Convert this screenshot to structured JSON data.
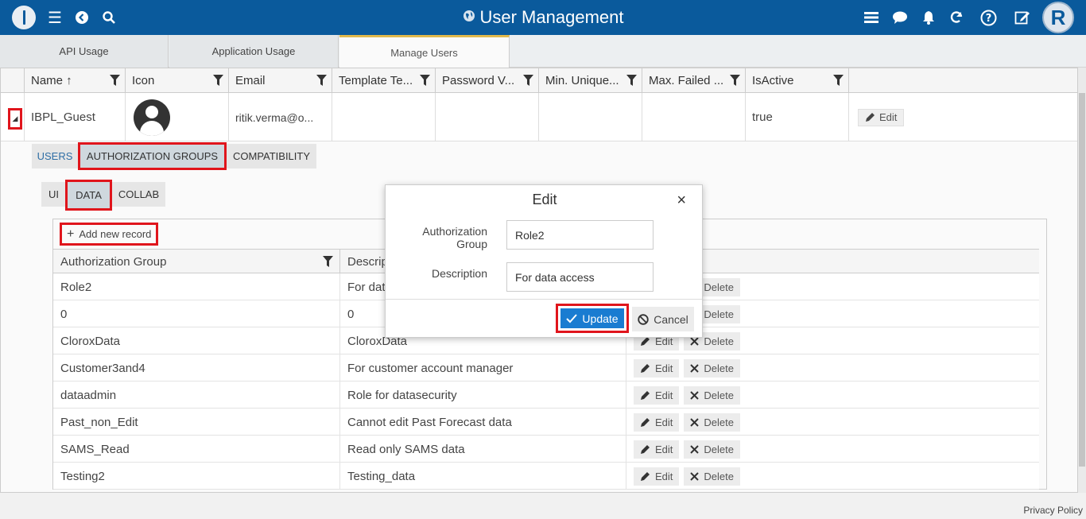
{
  "app": {
    "title": "User Management"
  },
  "tabs": [
    "API Usage",
    "Application Usage",
    "Manage Users"
  ],
  "grid": {
    "columns": [
      "Name ↑",
      "Icon",
      "Email",
      "Template Te...",
      "Password V...",
      "Min. Unique...",
      "Max. Failed ...",
      "IsActive"
    ],
    "row": {
      "name": "IBPL_Guest",
      "email": "ritik.verma@o...",
      "is_active": "true",
      "edit_label": "Edit"
    }
  },
  "detail": {
    "tabs": [
      "USERS",
      "AUTHORIZATION GROUPS",
      "COMPATIBILITY"
    ],
    "subtabs": [
      "UI",
      "DATA",
      "COLLAB"
    ],
    "add_record": "Add new record",
    "columns": [
      "Authorization Group",
      "Descrip"
    ],
    "rows": [
      {
        "group": "Role2",
        "description": "For dat"
      },
      {
        "group": "0",
        "description": "0"
      },
      {
        "group": "CloroxData",
        "description": "CloroxData"
      },
      {
        "group": "Customer3and4",
        "description": "For customer account manager"
      },
      {
        "group": "dataadmin",
        "description": "Role for datasecurity"
      },
      {
        "group": "Past_non_Edit",
        "description": "Cannot edit Past Forecast data"
      },
      {
        "group": "SAMS_Read",
        "description": "Read only SAMS data"
      },
      {
        "group": "Testing2",
        "description": "Testing_data"
      }
    ],
    "edit_label": "Edit",
    "delete_label": "Delete"
  },
  "modal": {
    "title": "Edit",
    "close": "×",
    "group_label_1": "Authorization",
    "group_label_2": "Group",
    "group_value": "Role2",
    "description_label": "Description",
    "description_value": "For data access",
    "update_label": "Update",
    "cancel_label": "Cancel"
  },
  "footer": {
    "privacy": "Privacy Policy"
  },
  "colors": {
    "topbar": "#0a5a9c",
    "accent_red": "#e0151c",
    "update_blue": "#1a7cd1",
    "tab_active": "#e0b84c"
  }
}
